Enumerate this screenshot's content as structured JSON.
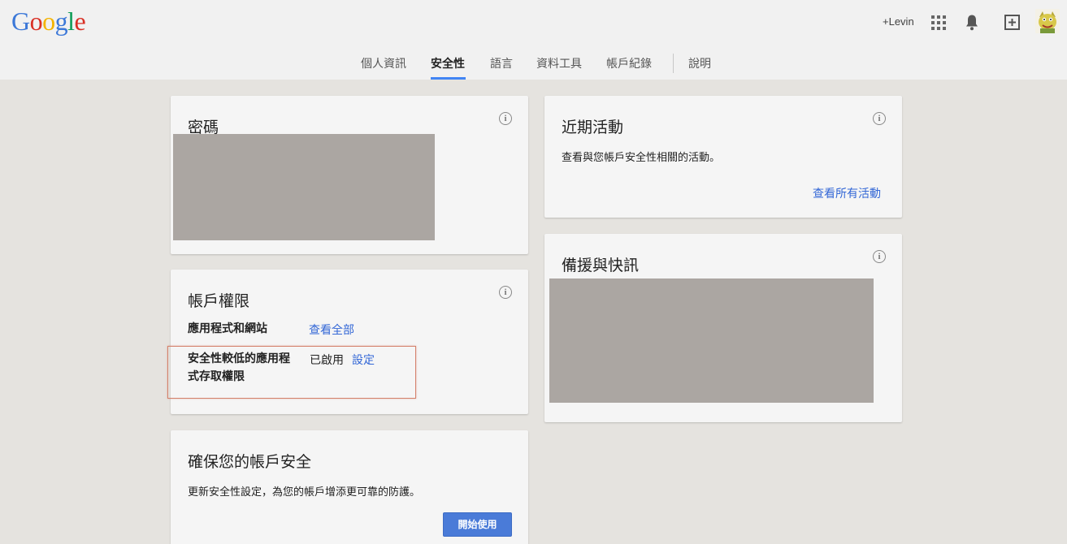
{
  "header": {
    "logo_letters": [
      {
        "ch": "G",
        "color": "#3c78d8"
      },
      {
        "ch": "o",
        "color": "#d93025"
      },
      {
        "ch": "o",
        "color": "#f4b400"
      },
      {
        "ch": "g",
        "color": "#3c78d8"
      },
      {
        "ch": "l",
        "color": "#0f9d58"
      },
      {
        "ch": "e",
        "color": "#d93025"
      }
    ],
    "user_name": "+Levin",
    "icons": [
      "apps-grid-icon",
      "notifications-bell-icon",
      "share-plus-icon",
      "avatar"
    ]
  },
  "nav": {
    "tabs": [
      {
        "label": "個人資訊",
        "active": false
      },
      {
        "label": "安全性",
        "active": true
      },
      {
        "label": "語言",
        "active": false
      },
      {
        "label": "資料工具",
        "active": false
      },
      {
        "label": "帳戶紀錄",
        "active": false
      },
      {
        "label": "說明",
        "active": false
      }
    ],
    "accent_color": "#4285f4"
  },
  "cards": {
    "password": {
      "title": "密碼",
      "info": "i"
    },
    "permissions": {
      "title": "帳戶權限",
      "info": "i",
      "apps_label": "應用程式和網站",
      "apps_link": "查看全部",
      "less_secure_label_line1": "安全性較低的應用程",
      "less_secure_label_line2": "式存取權限",
      "less_secure_status": "已啟用",
      "less_secure_link": "設定"
    },
    "secure": {
      "title": "確保您的帳戶安全",
      "description": "更新安全性設定，為您的帳戶增添更可靠的防護。",
      "button": "開始使用"
    },
    "activity": {
      "title": "近期活動",
      "info": "i",
      "description": "查看與您帳戶安全性相關的活動。",
      "link": "查看所有活動"
    },
    "recovery": {
      "title": "備援與快訊",
      "info": "i"
    }
  }
}
